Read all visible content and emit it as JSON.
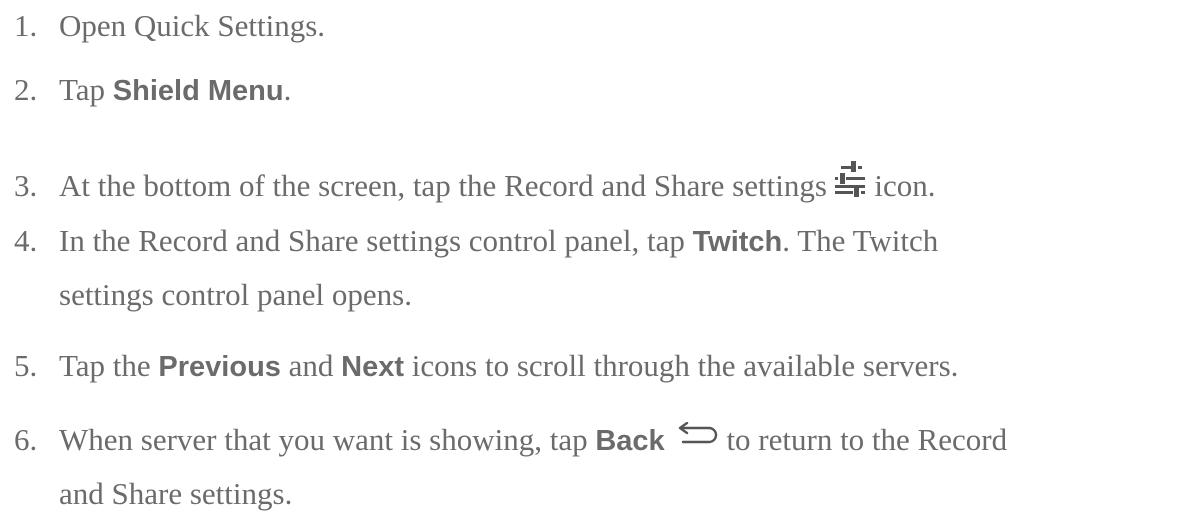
{
  "steps": [
    {
      "number": "1.",
      "text": "Open Quick Settings."
    },
    {
      "number": "2.",
      "pre": "Tap ",
      "bold": "Shield Menu",
      "post": "."
    },
    {
      "number": "3.",
      "pre": "At the bottom of the screen, tap the Record and Share settings ",
      "icon": "sliders-icon",
      "post": " icon."
    },
    {
      "number": "4.",
      "pre": "In the Record and Share settings control panel, tap ",
      "bold": "Twitch",
      "post": ". The Twitch",
      "continuation": "settings control panel opens."
    },
    {
      "number": "5.",
      "pre": "Tap the ",
      "bold1": "Previous",
      "mid": " and ",
      "bold2": "Next",
      "post": " icons to scroll through the available servers."
    },
    {
      "number": "6.",
      "pre": "When server that you want is showing, tap ",
      "bold": "Back",
      "icon": "back-arrow-icon",
      "post": " to return to the Record",
      "continuation": "and Share settings."
    }
  ],
  "colors": {
    "text": "#6b6b6b",
    "icon": "#555555"
  }
}
